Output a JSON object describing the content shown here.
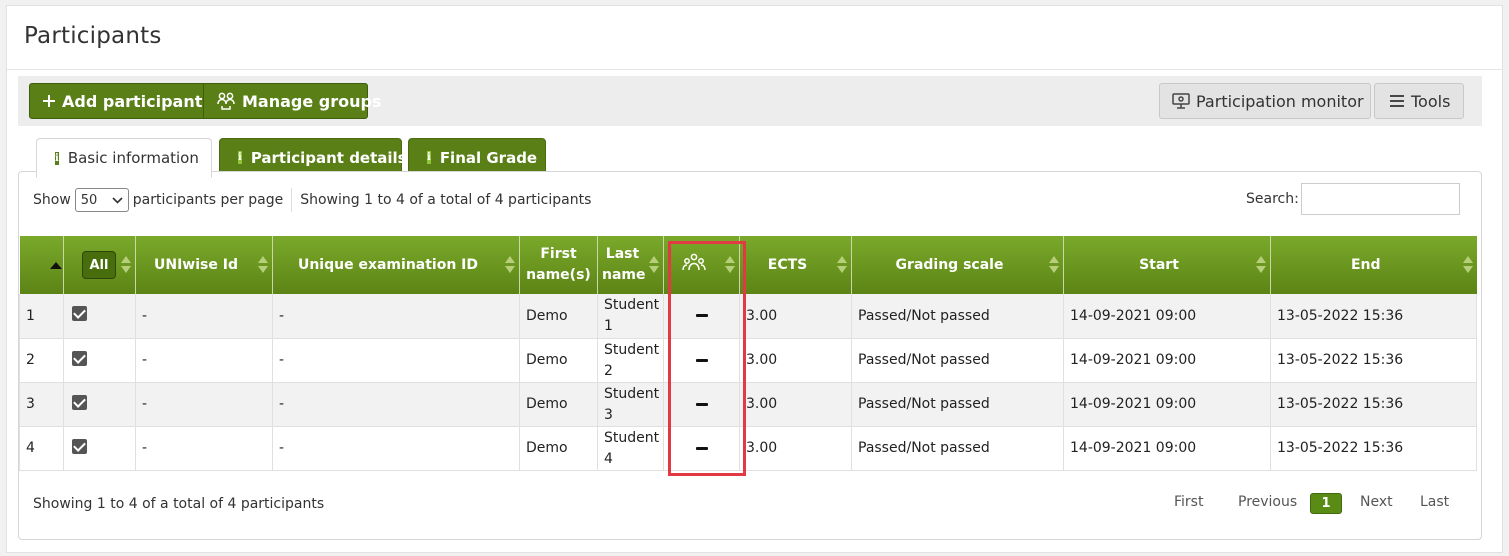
{
  "page": {
    "title": "Participants"
  },
  "toolbar": {
    "add_label": "Add participants",
    "groups_label": "Manage groups",
    "monitor_label": "Participation monitor",
    "tools_label": "Tools"
  },
  "tabs": [
    {
      "label": "Basic information",
      "active": true
    },
    {
      "label": "Participant details",
      "active": false
    },
    {
      "label": "Final Grade",
      "active": false
    }
  ],
  "list_controls": {
    "show_label": "Show",
    "page_size": "50",
    "per_page_label": "participants per page",
    "showing_text": "Showing 1 to 4 of a total of 4 participants",
    "search_label": "Search:",
    "search_value": ""
  },
  "table": {
    "headers": {
      "select_all": "All",
      "uniwise_id": "UNIwise Id",
      "exam_id": "Unique examination ID",
      "first_name": "First name(s)",
      "last_name": "Last name",
      "group_icon": "group-icon",
      "ects": "ECTS",
      "grading_scale": "Grading scale",
      "start": "Start",
      "end": "End"
    },
    "rows": [
      {
        "num": "1",
        "checked": true,
        "uniwise_id": "-",
        "exam_id": "-",
        "first_name": "Demo",
        "last_name": "Student 1",
        "group": "—",
        "ects": "3.00",
        "grading_scale": "Passed/Not passed",
        "start": "14-09-2021 09:00",
        "end": "13-05-2022 15:36"
      },
      {
        "num": "2",
        "checked": true,
        "uniwise_id": "-",
        "exam_id": "-",
        "first_name": "Demo",
        "last_name": "Student 2",
        "group": "—",
        "ects": "3.00",
        "grading_scale": "Passed/Not passed",
        "start": "14-09-2021 09:00",
        "end": "13-05-2022 15:36"
      },
      {
        "num": "3",
        "checked": true,
        "uniwise_id": "-",
        "exam_id": "-",
        "first_name": "Demo",
        "last_name": "Student 3",
        "group": "—",
        "ects": "3.00",
        "grading_scale": "Passed/Not passed",
        "start": "14-09-2021 09:00",
        "end": "13-05-2022 15:36"
      },
      {
        "num": "4",
        "checked": true,
        "uniwise_id": "-",
        "exam_id": "-",
        "first_name": "Demo",
        "last_name": "Student 4",
        "group": "—",
        "ects": "3.00",
        "grading_scale": "Passed/Not passed",
        "start": "14-09-2021 09:00",
        "end": "13-05-2022 15:36"
      }
    ]
  },
  "footer": {
    "showing_text": "Showing 1 to 4 of a total of 4 participants",
    "first": "First",
    "previous": "Previous",
    "current_page": "1",
    "next": "Next",
    "last": "Last"
  },
  "colors": {
    "brand_green": "#5a7f17",
    "header_green": "#7aa92a",
    "highlight_red": "#e23a44"
  }
}
